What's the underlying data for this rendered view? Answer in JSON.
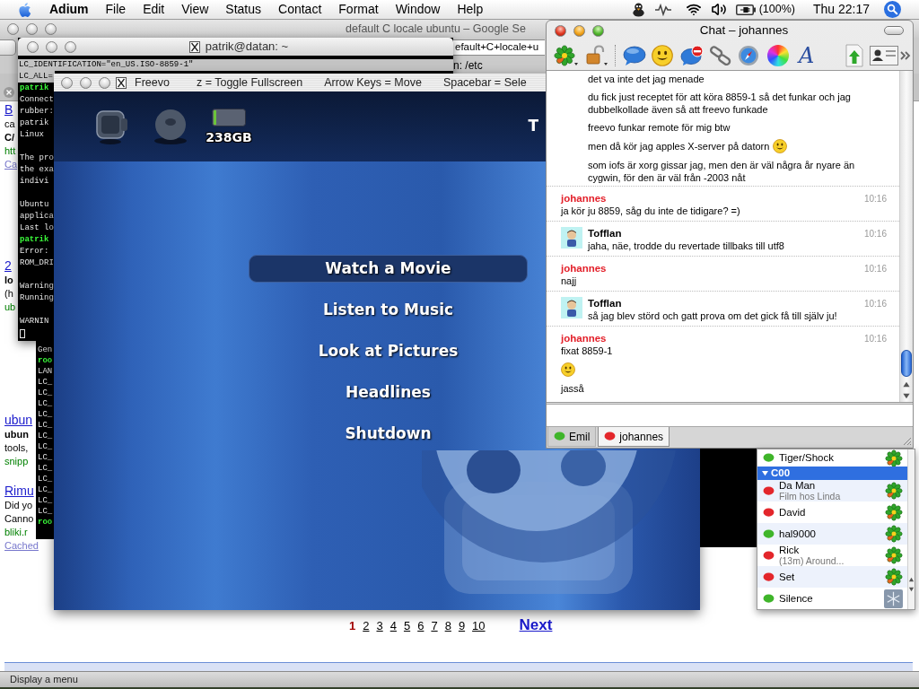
{
  "menu_bar": {
    "app": "Adium",
    "menus": [
      "File",
      "Edit",
      "View",
      "Status",
      "Contact",
      "Format",
      "Window",
      "Help"
    ],
    "battery": "(100%)",
    "clock": "Thu 22:17"
  },
  "browser": {
    "title": "default C locale ubuntu – Google Se",
    "address": "efault+C+locale+u",
    "toolbar_text": "n: /etc",
    "results": [
      {
        "lines": [
          {
            "kind": "title",
            "text": "B"
          },
          {
            "kind": "snippet",
            "text": "ca"
          },
          {
            "kind": "bold",
            "text": "C/"
          },
          {
            "kind": "url",
            "text": "htt"
          },
          {
            "kind": "cached",
            "text": "Ca"
          }
        ]
      },
      {
        "lines": [
          {
            "kind": "title",
            "text": "2"
          },
          {
            "kind": "bold",
            "text": "lo"
          },
          {
            "kind": "snippet",
            "text": "(h"
          },
          {
            "kind": "url",
            "text": "ub"
          }
        ]
      },
      {
        "lines": [
          {
            "kind": "title",
            "text": "ubun"
          },
          {
            "kind": "bold",
            "text": "ubun"
          },
          {
            "kind": "snippet",
            "text": "tools,"
          },
          {
            "kind": "url",
            "text": "snipp"
          }
        ]
      },
      {
        "lines": [
          {
            "kind": "title",
            "text": "Rimu"
          },
          {
            "kind": "snippet",
            "text": "Did yo"
          },
          {
            "kind": "snippet",
            "text": "Canno"
          },
          {
            "kind": "url",
            "text": "bliki.r"
          },
          {
            "kind": "cached",
            "text": "Cached"
          }
        ]
      }
    ],
    "pages": [
      {
        "label": "1",
        "selected": true
      },
      {
        "label": "2",
        "selected": false
      },
      {
        "label": "3",
        "selected": false
      },
      {
        "label": "4",
        "selected": false
      },
      {
        "label": "5",
        "selected": false
      },
      {
        "label": "6",
        "selected": false
      },
      {
        "label": "7",
        "selected": false
      },
      {
        "label": "8",
        "selected": false
      },
      {
        "label": "9",
        "selected": false
      },
      {
        "label": "10",
        "selected": false
      }
    ],
    "next": "Next",
    "status": "Display a menu"
  },
  "terminal_back": {
    "lines": [
      {
        "kind": "output",
        "text": "Gen"
      },
      {
        "kind": "prompt",
        "text": "roo"
      },
      {
        "kind": "output",
        "text": "LAN"
      },
      {
        "kind": "output",
        "text": "LC_"
      },
      {
        "kind": "output",
        "text": "LC_"
      },
      {
        "kind": "output",
        "text": "LC_"
      },
      {
        "kind": "output",
        "text": "LC_"
      },
      {
        "kind": "output",
        "text": "LC_"
      },
      {
        "kind": "output",
        "text": "LC_"
      },
      {
        "kind": "output",
        "text": "LC_"
      },
      {
        "kind": "output",
        "text": "LC_"
      },
      {
        "kind": "output",
        "text": "LC_"
      },
      {
        "kind": "output",
        "text": "LC_"
      },
      {
        "kind": "output",
        "text": "LC_"
      },
      {
        "kind": "output",
        "text": "LC_"
      },
      {
        "kind": "output",
        "text": "LC_"
      },
      {
        "kind": "prompt",
        "text": "roo"
      }
    ]
  },
  "terminal_front": {
    "title": "patrik@datan: ~",
    "highlighted_lines": [
      "LC_IDENTIFICATION=\"en_US.ISO-8859-1\"",
      "LC_ALL="
    ],
    "lines": [
      {
        "kind": "prompt",
        "text": "patrik"
      },
      {
        "kind": "output",
        "text": "Connect"
      },
      {
        "kind": "output",
        "text": "rubber:"
      },
      {
        "kind": "output",
        "text": "patrik"
      },
      {
        "kind": "output",
        "text": "Linux"
      },
      {
        "kind": "blank"
      },
      {
        "kind": "output",
        "text": "The pro"
      },
      {
        "kind": "output",
        "text": "the exa"
      },
      {
        "kind": "output",
        "text": "indivi"
      },
      {
        "kind": "blank"
      },
      {
        "kind": "output",
        "text": "Ubuntu"
      },
      {
        "kind": "output",
        "text": "applica"
      },
      {
        "kind": "output",
        "text": "Last lo"
      },
      {
        "kind": "prompt",
        "text": "patrik"
      },
      {
        "kind": "output",
        "text": "Error:"
      },
      {
        "kind": "output",
        "text": "ROM_DRI"
      },
      {
        "kind": "blank"
      },
      {
        "kind": "output",
        "text": "Warning"
      },
      {
        "kind": "output",
        "text": "Running"
      },
      {
        "kind": "blank"
      },
      {
        "kind": "output",
        "text": "WARNIN"
      },
      {
        "kind": "cursor"
      }
    ]
  },
  "freevo": {
    "title": "Freevo",
    "hints": [
      "z = Toggle Fullscreen",
      "Arrow Keys = Move",
      "Spacebar = Sele"
    ],
    "disk": "238GB",
    "header_text": "T",
    "menu": [
      {
        "label": "Watch a Movie",
        "selected": true
      },
      {
        "label": "Listen to Music",
        "selected": false
      },
      {
        "label": "Look at Pictures",
        "selected": false
      },
      {
        "label": "Headlines",
        "selected": false
      },
      {
        "label": "Shutdown",
        "selected": false
      }
    ]
  },
  "buddy_list": {
    "buddies": [
      {
        "name": "Tiger/Shock",
        "color": "#3fb52a",
        "kind": "flower"
      }
    ],
    "groups": [
      {
        "name": "C00",
        "expanded": true,
        "buddies": [
          {
            "name": "Da Man",
            "status": "Film hos Linda",
            "color": "#e3262b",
            "kind": "flower"
          },
          {
            "name": "David",
            "color": "#e3262b",
            "kind": "flower"
          },
          {
            "name": "hal9000",
            "color": "#3fb52a",
            "kind": "flower"
          },
          {
            "name": "Rick",
            "status": "(13m) Around...",
            "color": "#e3262b",
            "kind": "flower"
          },
          {
            "name": "Set",
            "color": "#e3262b",
            "kind": "flower"
          },
          {
            "name": "Silence",
            "color": "#3fb52a",
            "kind": "tile"
          }
        ]
      }
    ]
  },
  "chat": {
    "title": "Chat – johannes",
    "font_button": "A",
    "messages": [
      {
        "kind": "outgoing",
        "lines": [
          {
            "kind": "text",
            "text": "det va inte det jag menade",
            "emoticon": false
          },
          {
            "kind": "text",
            "text": "du fick just receptet för att köra 8859-1 så det funkar och jag dubbelkollade även så att freevo funkade",
            "emoticon": false
          },
          {
            "kind": "text",
            "text": "freevo funkar remote för mig btw",
            "emoticon": false
          },
          {
            "kind": "text",
            "text": "men då kör jag apples X-server på datorn",
            "emoticon": true
          },
          {
            "kind": "text",
            "text": "som iofs är xorg gissar jag, men den är väl några år nyare än cygwin, för den är väl från -2003 nåt",
            "emoticon": false
          }
        ]
      },
      {
        "kind": "incoming",
        "sender": "johannes",
        "time": "10:16",
        "lines": [
          {
            "kind": "text",
            "text": "ja kör ju 8859, såg du inte de tidigare? =)",
            "emoticon": false
          }
        ]
      },
      {
        "kind": "outgoing",
        "sender": "Tofflan",
        "time": "10:16",
        "lines": [
          {
            "kind": "text",
            "text": "jaha, näe, trodde du revertade tillbaks till utf8",
            "emoticon": false
          }
        ]
      },
      {
        "kind": "incoming",
        "sender": "johannes",
        "time": "10:16",
        "lines": [
          {
            "kind": "text",
            "text": "najj",
            "emoticon": false
          }
        ]
      },
      {
        "kind": "outgoing",
        "sender": "Tofflan",
        "time": "10:16",
        "lines": [
          {
            "kind": "text",
            "text": "så jag blev störd och gatt prova om det gick få till själv ju!",
            "emoticon": false
          }
        ]
      },
      {
        "kind": "incoming",
        "sender": "johannes",
        "time": "10:16",
        "lines": [
          {
            "kind": "text",
            "text": "fixat 8859-1",
            "emoticon": false
          },
          {
            "kind": "emoticon"
          },
          {
            "kind": "text",
            "text": "jasså",
            "emoticon": false
          }
        ]
      }
    ],
    "tabs": [
      {
        "label": "Emil",
        "selected": false,
        "color": "#3fb52a"
      },
      {
        "label": "johannes",
        "selected": true,
        "color": "#e3262b"
      }
    ]
  }
}
